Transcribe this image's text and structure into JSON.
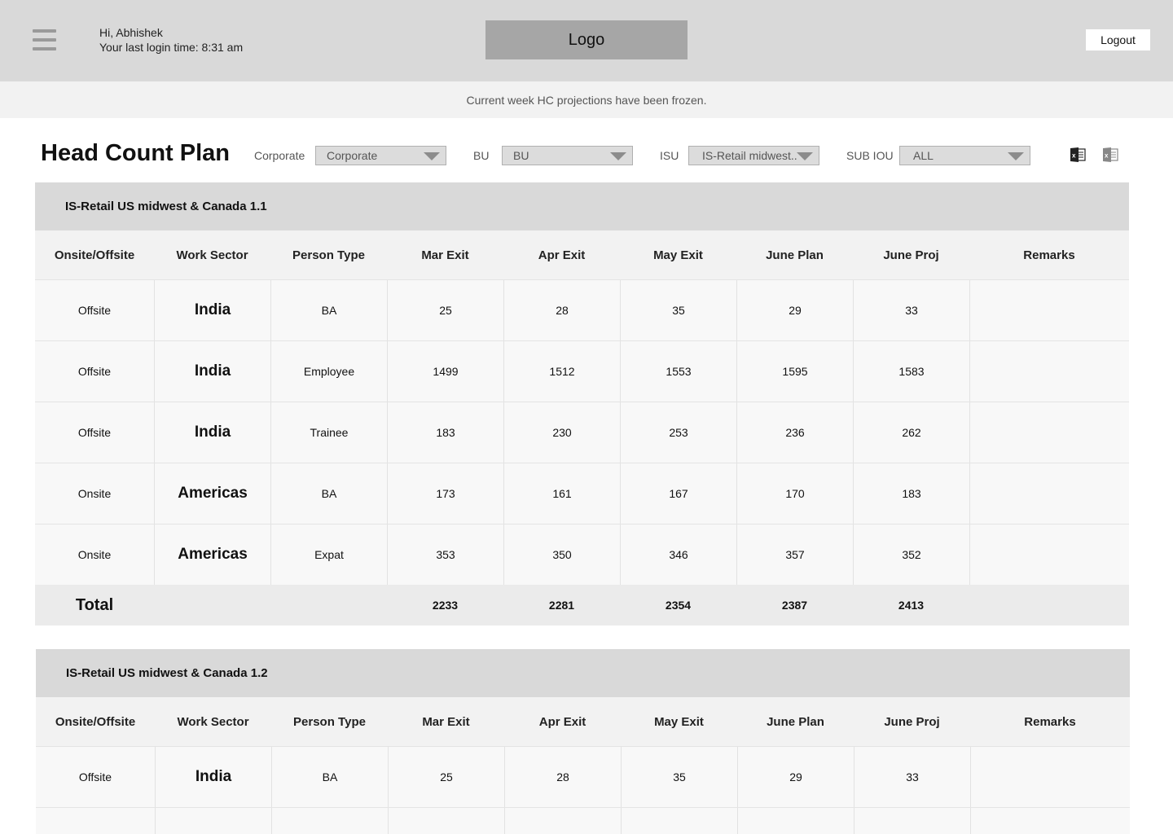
{
  "header": {
    "greeting": "Hi, Abhishek",
    "last_login": "Your last login time: 8:31 am",
    "logo": "Logo",
    "logout": "Logout",
    "menu_icon": "hamburger-menu-icon"
  },
  "notice": "Current week HC projections have been frozen.",
  "page": {
    "title": "Head Count Plan"
  },
  "filters": {
    "corporate": {
      "label": "Corporate",
      "value": "Corporate"
    },
    "bu": {
      "label": "BU",
      "value": "BU"
    },
    "isu": {
      "label": "ISU",
      "value": "IS-Retail midwest.."
    },
    "sub_iou": {
      "label": "SUB IOU",
      "value": "ALL"
    }
  },
  "export_icons": [
    "excel-export-icon",
    "excel-export-disabled-icon"
  ],
  "columns": [
    "Onsite/Offsite",
    "Work Sector",
    "Person Type",
    "Mar Exit",
    "Apr Exit",
    "May Exit",
    "June Plan",
    "June Proj",
    "Remarks"
  ],
  "tables": [
    {
      "title": "IS-Retail US midwest & Canada 1.1",
      "rows": [
        {
          "site": "Offsite",
          "sector": "India",
          "type": "BA",
          "mar": "25",
          "apr": "28",
          "may": "35",
          "jun_plan": "29",
          "jun_proj": "33",
          "remarks": ""
        },
        {
          "site": "Offsite",
          "sector": "India",
          "type": "Employee",
          "mar": "1499",
          "apr": "1512",
          "may": "1553",
          "jun_plan": "1595",
          "jun_proj": "1583",
          "remarks": ""
        },
        {
          "site": "Offsite",
          "sector": "India",
          "type": "Trainee",
          "mar": "183",
          "apr": "230",
          "may": "253",
          "jun_plan": "236",
          "jun_proj": "262",
          "remarks": ""
        },
        {
          "site": "Onsite",
          "sector": "Americas",
          "type": "BA",
          "mar": "173",
          "apr": "161",
          "may": "167",
          "jun_plan": "170",
          "jun_proj": "183",
          "remarks": ""
        },
        {
          "site": "Onsite",
          "sector": "Americas",
          "type": "Expat",
          "mar": "353",
          "apr": "350",
          "may": "346",
          "jun_plan": "357",
          "jun_proj": "352",
          "remarks": ""
        }
      ],
      "total": {
        "label": "Total",
        "mar": "2233",
        "apr": "2281",
        "may": "2354",
        "jun_plan": "2387",
        "jun_proj": "2413"
      }
    },
    {
      "title": "IS-Retail US midwest & Canada 1.2",
      "rows": [
        {
          "site": "Offsite",
          "sector": "India",
          "type": "BA",
          "mar": "25",
          "apr": "28",
          "may": "35",
          "jun_plan": "29",
          "jun_proj": "33",
          "remarks": ""
        }
      ]
    }
  ]
}
